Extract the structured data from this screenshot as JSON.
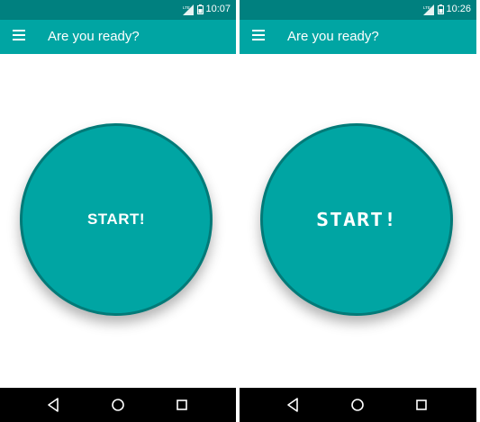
{
  "screens": [
    {
      "status": {
        "time": "10:07"
      },
      "appbar": {
        "title": "Are you ready?"
      },
      "start_button": {
        "label": "START!"
      },
      "nav": {
        "back_icon": "back-icon",
        "home_icon": "home-icon",
        "recent_icon": "recent-apps-icon"
      }
    },
    {
      "status": {
        "time": "10:26"
      },
      "appbar": {
        "title": "Are you ready?"
      },
      "start_button": {
        "label": "START!"
      },
      "nav": {
        "back_icon": "back-icon",
        "home_icon": "home-icon",
        "recent_icon": "recent-apps-icon"
      }
    }
  ],
  "colors": {
    "statusbar": "#00807f",
    "appbar": "#00a5a3",
    "button": "#00a5a3",
    "button_border": "#027a78",
    "navbar": "#000000"
  }
}
